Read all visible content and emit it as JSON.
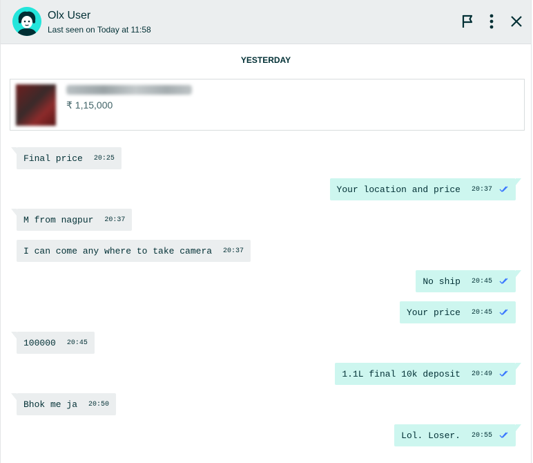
{
  "header": {
    "user_name": "Olx User",
    "last_seen": "Last seen on Today at 11:58",
    "avatar_icon": "user-avatar-icon",
    "icons": [
      "flag-icon",
      "more-vert-icon",
      "close-icon"
    ]
  },
  "day_separator": "YESTERDAY",
  "product": {
    "price": "₹ 1,15,000"
  },
  "messages": [
    {
      "dir": "in",
      "text": "Final price",
      "time": "20:25"
    },
    {
      "dir": "out",
      "text": "Your location and price",
      "time": "20:37"
    },
    {
      "dir": "in",
      "text": "M from nagpur",
      "time": "20:37"
    },
    {
      "dir": "in",
      "text": "I can come any where to take camera",
      "time": "20:37"
    },
    {
      "dir": "out",
      "text": "No ship",
      "time": "20:45"
    },
    {
      "dir": "out",
      "text": "Your price",
      "time": "20:45"
    },
    {
      "dir": "in",
      "text": "100000",
      "time": "20:45"
    },
    {
      "dir": "out",
      "text": "1.1L final 10k deposit",
      "time": "20:49"
    },
    {
      "dir": "in",
      "text": "Bhok me ja",
      "time": "20:50"
    },
    {
      "dir": "out",
      "text": "Lol. Loser.",
      "time": "20:55"
    }
  ],
  "colors": {
    "header_bg": "#ebeeef",
    "incoming_bubble": "#ebeeef",
    "outgoing_bubble": "#cdf6ef",
    "avatar_bg": "#23e5db",
    "read_tick": "#3a77ff"
  }
}
